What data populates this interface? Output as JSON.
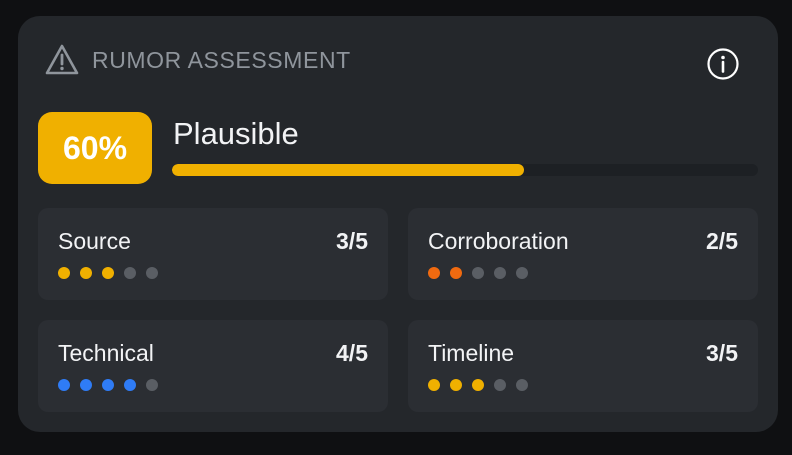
{
  "header": {
    "title": "RUMOR ASSESSMENT",
    "warning_icon": "warning-triangle-icon",
    "info_icon": "info-icon"
  },
  "assessment": {
    "score_label": "60%",
    "score_fraction": 0.6,
    "verdict": "Plausible",
    "accent_color": "#f0b000"
  },
  "metrics": [
    {
      "key": "source",
      "label": "Source",
      "score": "3/5",
      "filled": 3,
      "total": 5,
      "color": "#f0b000"
    },
    {
      "key": "corroboration",
      "label": "Corroboration",
      "score": "2/5",
      "filled": 2,
      "total": 5,
      "color": "#f06a10"
    },
    {
      "key": "technical",
      "label": "Technical",
      "score": "4/5",
      "filled": 4,
      "total": 5,
      "color": "#2f7cf6"
    },
    {
      "key": "timeline",
      "label": "Timeline",
      "score": "3/5",
      "filled": 3,
      "total": 5,
      "color": "#f0b000"
    }
  ],
  "colors": {
    "empty_dot": "#5a5e64",
    "card_bg": "#24272b",
    "tile_bg": "#2b2e33"
  }
}
